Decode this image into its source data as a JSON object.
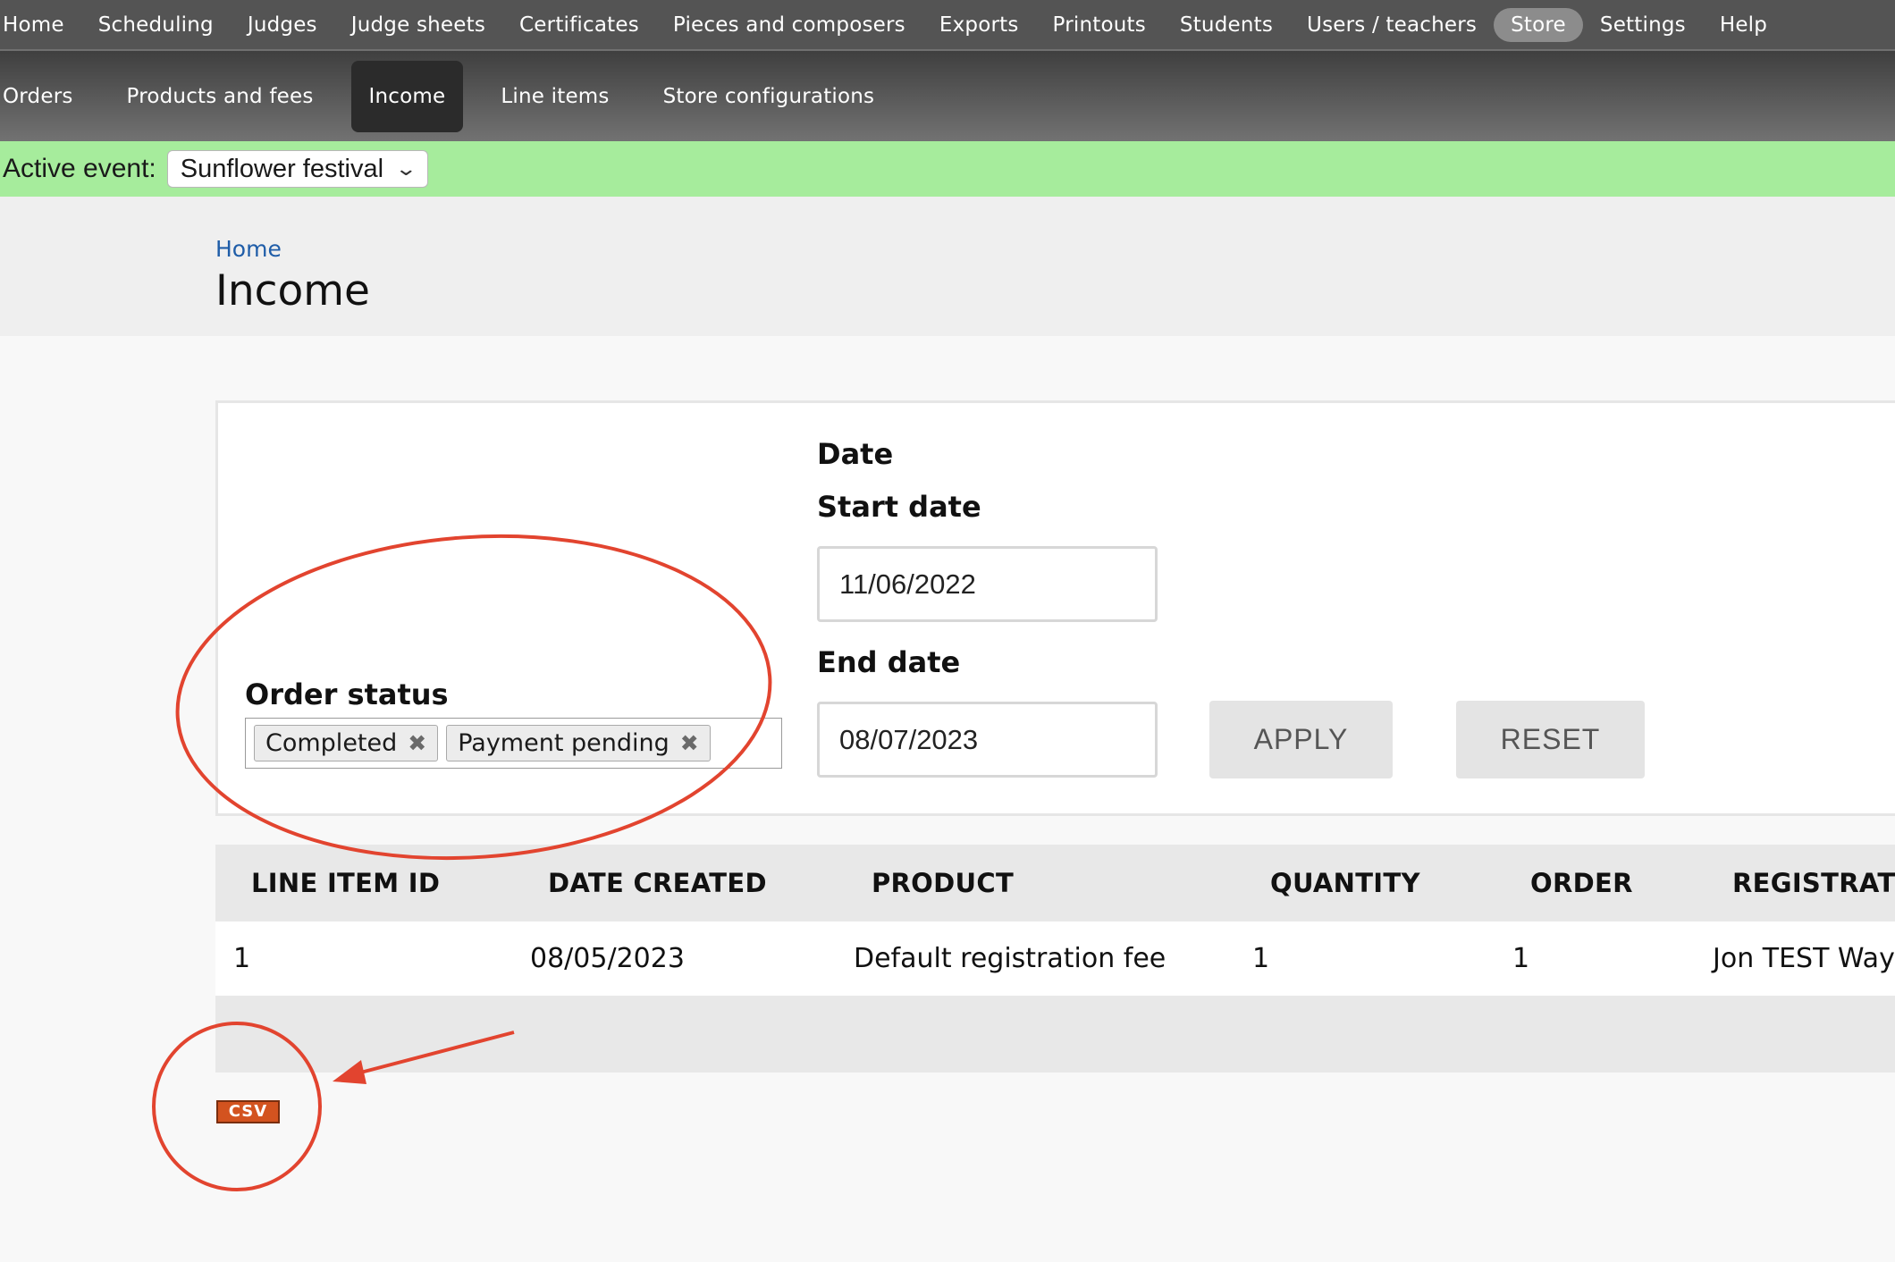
{
  "topnav": {
    "items": [
      "Home",
      "Scheduling",
      "Judges",
      "Judge sheets",
      "Certificates",
      "Pieces and composers",
      "Exports",
      "Printouts",
      "Students",
      "Users / teachers",
      "Store",
      "Settings",
      "Help"
    ],
    "active": "Store"
  },
  "subnav": {
    "items": [
      "Orders",
      "Products and fees",
      "Income",
      "Line items",
      "Store configurations"
    ],
    "active": "Income"
  },
  "event": {
    "label": "Active event:",
    "selected": "Sunflower festival"
  },
  "breadcrumb": "Home",
  "page_title": "Income",
  "filters": {
    "order_status_label": "Order status",
    "order_status_chips": [
      "Completed",
      "Payment pending"
    ],
    "date_label": "Date",
    "start_date_label": "Start date",
    "start_date_value": "11/06/2022",
    "end_date_label": "End date",
    "end_date_value": "08/07/2023",
    "apply_label": "APPLY",
    "reset_label": "RESET"
  },
  "table": {
    "headers": [
      "LINE ITEM ID",
      "DATE CREATED",
      "PRODUCT",
      "QUANTITY",
      "ORDER",
      "REGISTRATIO"
    ],
    "rows": [
      [
        "1",
        "08/05/2023",
        "Default registration fee",
        "1",
        "1",
        "Jon TEST Wayn"
      ]
    ]
  },
  "csv_label": "CSV",
  "annotation_color": "#e2442f",
  "colors": {
    "toolbar": "#545454",
    "event_bar": "#a6ec9c",
    "link": "#1f5da8",
    "csv": "#d3531f"
  }
}
